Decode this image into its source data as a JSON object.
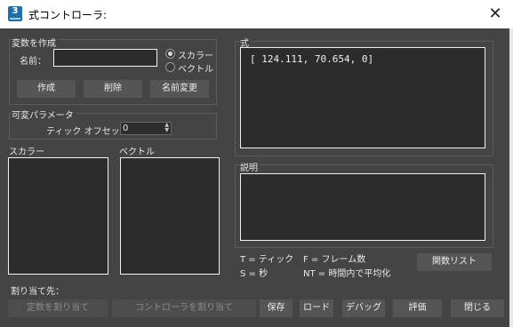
{
  "titlebar": {
    "app_icon_text": "3",
    "title": "式コントローラ:",
    "close_glyph": "✕"
  },
  "create_variable": {
    "group_label": "変数を作成",
    "name_label": "名前：",
    "name_value": "",
    "type_options": [
      "スカラー",
      "ベクトル"
    ],
    "selected_type": "スカラー",
    "create_label": "作成",
    "delete_label": "削除",
    "rename_label": "名前変更"
  },
  "variable_params": {
    "group_label": "可変パラメータ",
    "tick_offset_label": "ティック オフセット：",
    "tick_offset_value": "0"
  },
  "lists": {
    "scalar_label": "スカラー",
    "vector_label": "ベクトル"
  },
  "expression": {
    "label": "式",
    "text": "[ 124.111, 70.654, 0]"
  },
  "description": {
    "label": "説明",
    "text": ""
  },
  "legend": {
    "t": "T = ティック",
    "f": "F = フレーム数",
    "s": "S = 秒",
    "nt": "NT = 時間内で平均化"
  },
  "function_list_label": "関数リスト",
  "assign_to": {
    "label": "割り当て先：",
    "assign_var_label": "定数を割り当て",
    "assign_ctrl_label": "コントローラを割り当て"
  },
  "buttons": {
    "save": "保存",
    "load": "ロード",
    "debug": "デバッグ",
    "evaluate": "評価",
    "close": "閉じる"
  }
}
